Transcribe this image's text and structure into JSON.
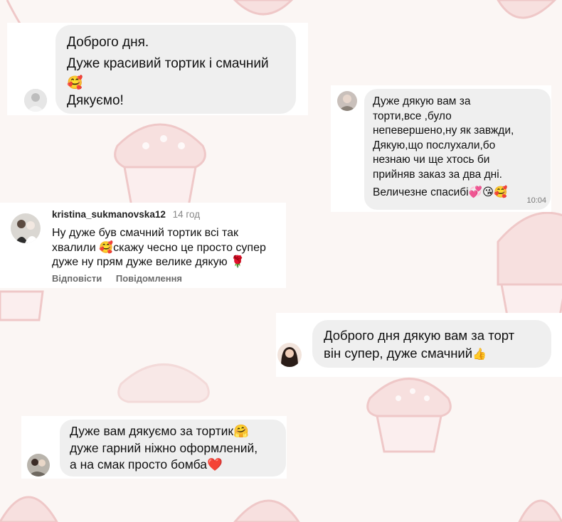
{
  "messages": [
    {
      "lines": [
        "Доброго дня.",
        "Дуже красивий тортик і смачний"
      ],
      "emoji_line": "🥰",
      "last_line": "Дякуємо!"
    },
    {
      "lines": [
        "Дуже дякую вам за",
        "торти,все ,було",
        "непевершено,ну як завжди,",
        "Дякую,що послухали,бо",
        "незнаю чи ще хтось би",
        "прийняв заказ за два дні."
      ],
      "last_line": "Величезне спасибі",
      "last_emoji": "💞😘🥰",
      "time": "10:04"
    },
    {
      "username": "kristina_sukmanovska12",
      "age": "14 год",
      "lines": [
        "Ну дуже був смачний тортик всі так"
      ],
      "line2_a": "хвалили ",
      "line2_emoji": "🥰",
      "line2_b": "скажу чесно це просто супер",
      "line3": "дуже ну прям дуже велике дякую ",
      "line3_emoji": "🌹",
      "reply_label": "Відповісти",
      "report_label": "Повідомлення"
    },
    {
      "line1": "Доброго дня дякую вам за торт",
      "line2": "він супер, дуже смачний",
      "emoji": "👍"
    },
    {
      "line1": "Дуже вам дякуємо за тортик",
      "line1_emoji": "🤗",
      "line2": "дуже гарний ніжно оформлений,",
      "line3": "а на смак просто бомба",
      "line3_emoji": "❤️"
    }
  ],
  "colors": {
    "cupcake_pink": "#f6dcdc",
    "cupcake_line": "#f0c9c9",
    "bubble_bg": "#efefef",
    "meta_gray": "#666666"
  }
}
